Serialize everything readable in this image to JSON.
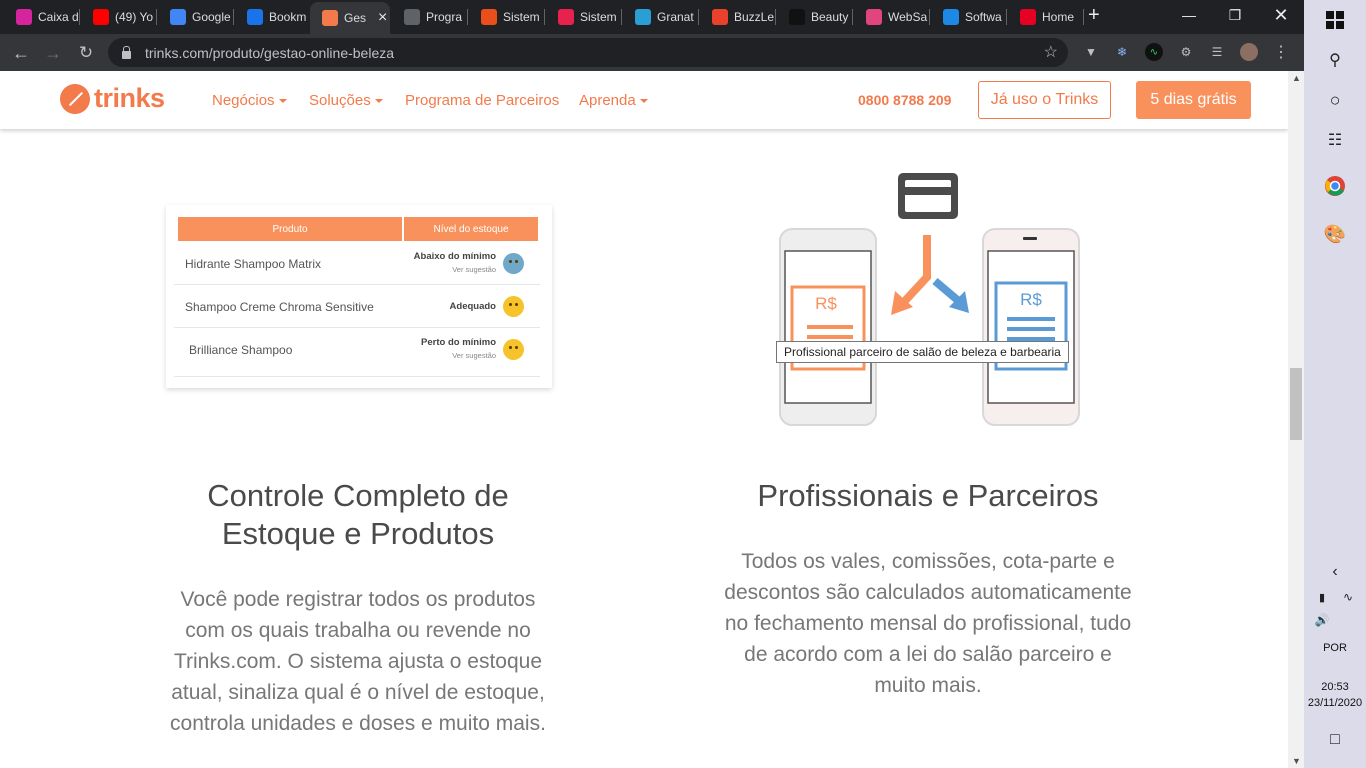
{
  "browser": {
    "tabs": [
      {
        "label": "Caixa d",
        "favicon": "instagram-icon",
        "color": "#d6249f"
      },
      {
        "label": "(49) Yo",
        "favicon": "youtube-icon",
        "color": "#ff0000"
      },
      {
        "label": "Google",
        "favicon": "google-calendar-icon",
        "color": "#4285f4"
      },
      {
        "label": "Bookm",
        "favicon": "star-icon",
        "color": "#1a73e8"
      },
      {
        "label": "Ges",
        "favicon": "trinks-icon",
        "color": "#f27a4b",
        "active": true
      },
      {
        "label": "Progra",
        "favicon": "globe-icon",
        "color": "#5f6368"
      },
      {
        "label": "Sistem",
        "favicon": "flag-icon",
        "color": "#e94e1b"
      },
      {
        "label": "Sistem",
        "favicon": "s-logo-icon",
        "color": "#e8214f"
      },
      {
        "label": "Granat",
        "favicon": "g-logo-icon",
        "color": "#2a9fd6"
      },
      {
        "label": "BuzzLe",
        "favicon": "buzz-icon",
        "color": "#e8422c"
      },
      {
        "label": "Beauty",
        "favicon": "beats-icon",
        "color": "#111111"
      },
      {
        "label": "WebSa",
        "favicon": "websa-icon",
        "color": "#e0457b"
      },
      {
        "label": "Softwa",
        "favicon": "software-icon",
        "color": "#1e88e5"
      },
      {
        "label": "Home",
        "favicon": "pinterest-icon",
        "color": "#e60023"
      }
    ],
    "new_tab": "+",
    "url": "trinks.com/produto/gestao-online-beleza"
  },
  "site": {
    "logo": "trinks",
    "nav": [
      {
        "label": "Negócios",
        "dropdown": true
      },
      {
        "label": "Soluções",
        "dropdown": true
      },
      {
        "label": "Programa de Parceiros",
        "dropdown": false
      },
      {
        "label": "Aprenda",
        "dropdown": true
      }
    ],
    "phone": "0800 8788 209",
    "btn_existing": "Já uso o Trinks",
    "btn_trial": "5 dias grátis",
    "accent": "#f27a4b"
  },
  "stock_table": {
    "headers": [
      "Produto",
      "Nível do estoque"
    ],
    "rows": [
      {
        "product": "Hidrante Shampoo Matrix",
        "level": "Abaixo do mínimo",
        "note": "Ver sugestão",
        "face": "worried"
      },
      {
        "product": "Shampoo Creme Chroma Sensitive",
        "level": "Adequado",
        "note": "",
        "face": "happy"
      },
      {
        "product": "Brilliance Shampoo",
        "level": "Perto do mínimo",
        "note": "Ver sugestão",
        "face": "neutral"
      }
    ]
  },
  "illustration": {
    "currency_left": "R$",
    "currency_right": "R$",
    "tooltip": "Profissional parceiro de salão de beleza e barbearia"
  },
  "features": [
    {
      "title": "Controle Completo de Estoque e Produtos",
      "body": "Você pode registrar todos os produtos com os quais trabalha ou revende no Trinks.com. O sistema ajusta o estoque atual, sinaliza qual é o nível de estoque, controla unidades e doses e muito mais."
    },
    {
      "title": "Profissionais e Parceiros",
      "body": "Todos os vales, comissões, cota-parte e descontos são calculados automaticamente no fechamento mensal do profissional, tudo de acordo com a lei do salão parceiro e muito mais."
    }
  ],
  "taskbar": {
    "language": "POR",
    "time": "20:53",
    "date": "23/11/2020"
  }
}
